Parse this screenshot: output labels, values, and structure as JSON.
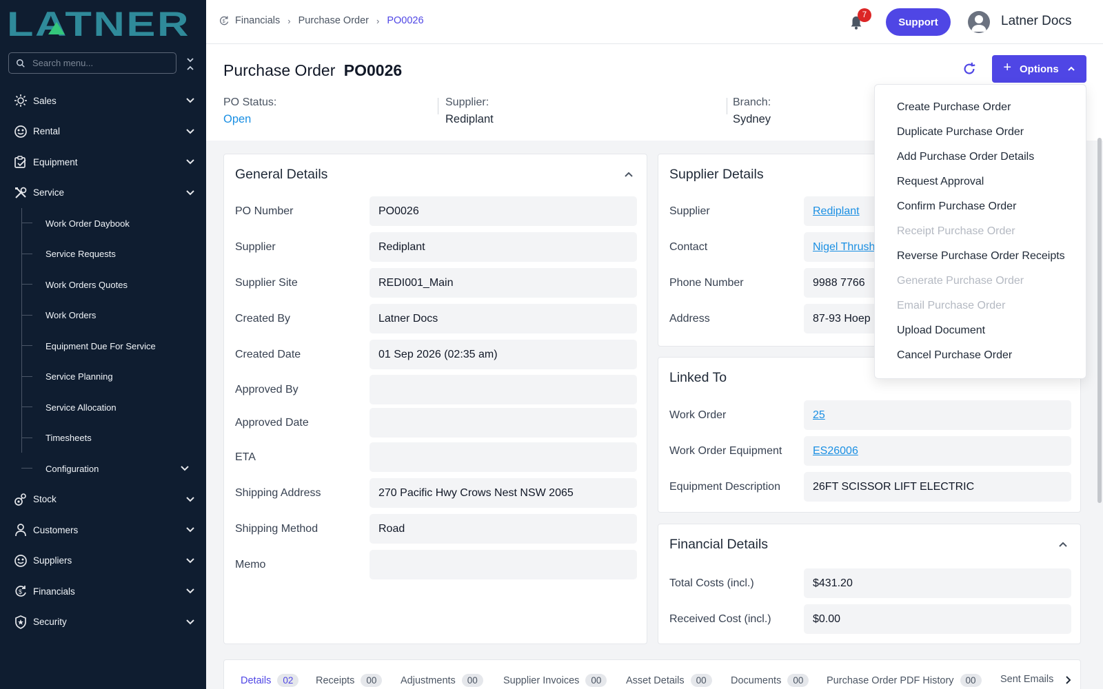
{
  "app": {
    "logo_text": "LATNER"
  },
  "sidebar": {
    "search_placeholder": "Search menu...",
    "items": [
      {
        "label": "Sales",
        "icon": "sales-icon"
      },
      {
        "label": "Rental",
        "icon": "rental-icon"
      },
      {
        "label": "Equipment",
        "icon": "equipment-icon"
      },
      {
        "label": "Service",
        "icon": "service-icon"
      },
      {
        "label": "Stock",
        "icon": "stock-icon"
      },
      {
        "label": "Customers",
        "icon": "customers-icon"
      },
      {
        "label": "Suppliers",
        "icon": "suppliers-icon"
      },
      {
        "label": "Financials",
        "icon": "financials-icon"
      },
      {
        "label": "Security",
        "icon": "security-icon"
      }
    ],
    "service_sub": [
      "Work Order Daybook",
      "Service Requests",
      "Work Orders Quotes",
      "Work Orders",
      "Equipment Due For Service",
      "Service Planning",
      "Service Allocation",
      "Timesheets",
      "Configuration"
    ]
  },
  "topbar": {
    "breadcrumb": [
      "Financials",
      "Purchase Order",
      "PO0026"
    ],
    "notification_count": "7",
    "support_label": "Support",
    "user_name": "Latner Docs"
  },
  "header": {
    "title_prefix": "Purchase Order",
    "title_id": "PO0026",
    "options_label": "Options",
    "po_status_label": "PO Status:",
    "po_status_value": "Open",
    "supplier_label": "Supplier:",
    "supplier_value": "Rediplant",
    "branch_label": "Branch:",
    "branch_value": "Sydney"
  },
  "general": {
    "title": "General Details",
    "rows": [
      {
        "label": "PO Number",
        "value": "PO0026"
      },
      {
        "label": "Supplier",
        "value": "Rediplant"
      },
      {
        "label": "Supplier Site",
        "value": "REDI001_Main"
      },
      {
        "label": "Created By",
        "value": "Latner Docs"
      },
      {
        "label": "Created Date",
        "value": "01 Sep 2026 (02:35 am)"
      },
      {
        "label": "Approved By",
        "value": ""
      },
      {
        "label": "Approved Date",
        "value": ""
      },
      {
        "label": "ETA",
        "value": ""
      },
      {
        "label": "Shipping Address",
        "value": "270 Pacific Hwy Crows Nest NSW 2065"
      },
      {
        "label": "Shipping Method",
        "value": "Road"
      },
      {
        "label": "Memo",
        "value": ""
      }
    ]
  },
  "supplier_details": {
    "title": "Supplier Details",
    "rows": [
      {
        "label": "Supplier",
        "value": "Rediplant"
      },
      {
        "label": "Contact",
        "value": "Nigel Thrush"
      },
      {
        "label": "Phone Number",
        "value": "9988 7766"
      },
      {
        "label": "Address",
        "value": "87-93 Hoep"
      }
    ]
  },
  "linked": {
    "title": "Linked To",
    "rows": [
      {
        "label": "Work Order",
        "value": "25"
      },
      {
        "label": "Work Order Equipment",
        "value": "ES26006"
      },
      {
        "label": "Equipment Description",
        "value": "26FT SCISSOR LIFT ELECTRIC"
      }
    ]
  },
  "financial": {
    "title": "Financial Details",
    "rows": [
      {
        "label": "Total Costs (incl.)",
        "value": "$431.20"
      },
      {
        "label": "Received Cost (incl.)",
        "value": "$0.00"
      }
    ]
  },
  "options_menu": [
    {
      "label": "Create Purchase Order",
      "enabled": true
    },
    {
      "label": "Duplicate Purchase Order",
      "enabled": true
    },
    {
      "label": "Add Purchase Order Details",
      "enabled": true
    },
    {
      "label": "Request Approval",
      "enabled": true
    },
    {
      "label": "Confirm Purchase Order",
      "enabled": true
    },
    {
      "label": "Receipt Purchase Order",
      "enabled": false
    },
    {
      "label": "Reverse Purchase Order Receipts",
      "enabled": true
    },
    {
      "label": "Generate Purchase Order",
      "enabled": false
    },
    {
      "label": "Email Purchase Order",
      "enabled": false
    },
    {
      "label": "Upload Document",
      "enabled": true
    },
    {
      "label": "Cancel Purchase Order",
      "enabled": true
    }
  ],
  "tabs": [
    {
      "label": "Details",
      "count": "02"
    },
    {
      "label": "Receipts",
      "count": "00"
    },
    {
      "label": "Adjustments",
      "count": "00"
    },
    {
      "label": "Supplier Invoices",
      "count": "00"
    },
    {
      "label": "Asset Details",
      "count": "00"
    },
    {
      "label": "Documents",
      "count": "00"
    },
    {
      "label": "Purchase Order PDF History",
      "count": "00"
    },
    {
      "label": "Sent Emails",
      "count": ""
    }
  ],
  "colors": {
    "sidebar_bg": "#0f1d30",
    "accent": "#4f46e5",
    "link": "#1a8fe3",
    "logo_teal": "#2f8a9a",
    "logo_green": "#34c77b",
    "badge": "#dc2626"
  }
}
